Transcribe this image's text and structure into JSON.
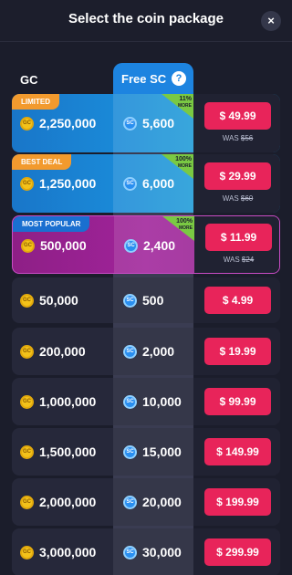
{
  "header": {
    "title": "Select the coin package",
    "close_icon": "×"
  },
  "columns": {
    "gc": "GC",
    "free_sc": "Free SC",
    "help_icon": "?"
  },
  "coin_icons": {
    "gc": "GC",
    "sc": "SC"
  },
  "colors": {
    "accent_red": "#e8245a",
    "free_sc_blue": "#1d84e0",
    "more_green": "#7ac943",
    "tag_orange": "#f29a2e"
  },
  "packages": [
    {
      "tag": "LIMITED",
      "gc": "2,250,000",
      "sc": "5,600",
      "more_pct": "11%",
      "more_label": "MORE",
      "price": "$ 49.99",
      "was_label": "WAS",
      "was_price": "$56"
    },
    {
      "tag": "BEST DEAL",
      "gc": "1,250,000",
      "sc": "6,000",
      "more_pct": "100%",
      "more_label": "MORE",
      "price": "$ 29.99",
      "was_label": "WAS",
      "was_price": "$60"
    },
    {
      "tag": "MOST POPULAR",
      "gc": "500,000",
      "sc": "2,400",
      "more_pct": "100%",
      "more_label": "MORE",
      "price": "$ 11.99",
      "was_label": "WAS",
      "was_price": "$24"
    },
    {
      "gc": "50,000",
      "sc": "500",
      "price": "$ 4.99"
    },
    {
      "gc": "200,000",
      "sc": "2,000",
      "price": "$ 19.99"
    },
    {
      "gc": "1,000,000",
      "sc": "10,000",
      "price": "$ 99.99"
    },
    {
      "gc": "1,500,000",
      "sc": "15,000",
      "price": "$ 149.99"
    },
    {
      "gc": "2,000,000",
      "sc": "20,000",
      "price": "$ 199.99"
    },
    {
      "gc": "3,000,000",
      "sc": "30,000",
      "price": "$ 299.99"
    }
  ]
}
